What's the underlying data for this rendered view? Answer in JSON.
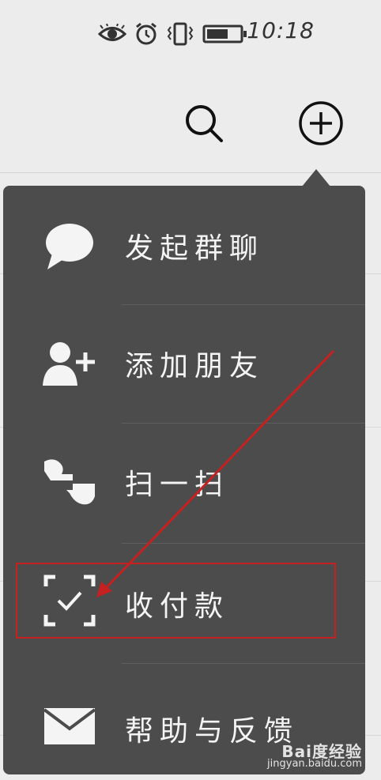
{
  "status_bar": {
    "time": "10:18",
    "icons": [
      "eye-icon",
      "alarm-icon",
      "vibrate-icon",
      "battery-icon"
    ]
  },
  "header": {
    "search_icon": "search-icon",
    "add_icon": "plus-circle-icon"
  },
  "menu": {
    "items": [
      {
        "label": "发起群聊",
        "icon": "chat-bubble-icon"
      },
      {
        "label": "添加朋友",
        "icon": "add-friend-icon"
      },
      {
        "label": "扫一扫",
        "icon": "scan-icon"
      },
      {
        "label": "收付款",
        "icon": "payment-scan-icon"
      },
      {
        "label": "帮助与反馈",
        "icon": "envelope-icon"
      }
    ]
  },
  "annotation": {
    "color": "#c62020",
    "highlighted_item": "收付款"
  },
  "watermark": {
    "brand": "Bai度经验",
    "url": "jingyan.baidu.com"
  }
}
